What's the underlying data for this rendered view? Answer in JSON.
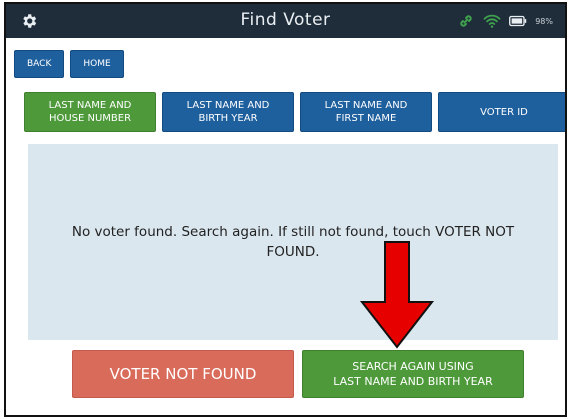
{
  "titlebar": {
    "title": "Find Voter",
    "battery_percent": "98%",
    "colors": {
      "background": "#1f2d3a",
      "link": "#3fa34d",
      "wifi": "#3fa34d"
    }
  },
  "nav": {
    "back_label": "BACK",
    "home_label": "HOME"
  },
  "search_tabs": [
    {
      "line1": "LAST NAME AND",
      "line2": "HOUSE NUMBER",
      "selected": true
    },
    {
      "line1": "LAST NAME AND",
      "line2": "BIRTH YEAR",
      "selected": false
    },
    {
      "line1": "LAST NAME AND",
      "line2": "FIRST NAME",
      "selected": false
    },
    {
      "line1": "VOTER ID",
      "line2": "",
      "selected": false
    }
  ],
  "message": {
    "line1": "No voter found. Search again. If still not found, touch VOTER NOT",
    "line2": "FOUND."
  },
  "actions": {
    "voter_not_found_label": "VOTER NOT FOUND",
    "search_again_line1": "SEARCH AGAIN USING",
    "search_again_line2": "LAST NAME AND BIRTH YEAR"
  },
  "annotation": {
    "arrow_color": "#e60000",
    "icon": "down-arrow-icon"
  },
  "colors": {
    "blue": "#1e5f9e",
    "green": "#4e9a3b",
    "red": "#d96b5b",
    "panel": "#dbe7ef"
  }
}
